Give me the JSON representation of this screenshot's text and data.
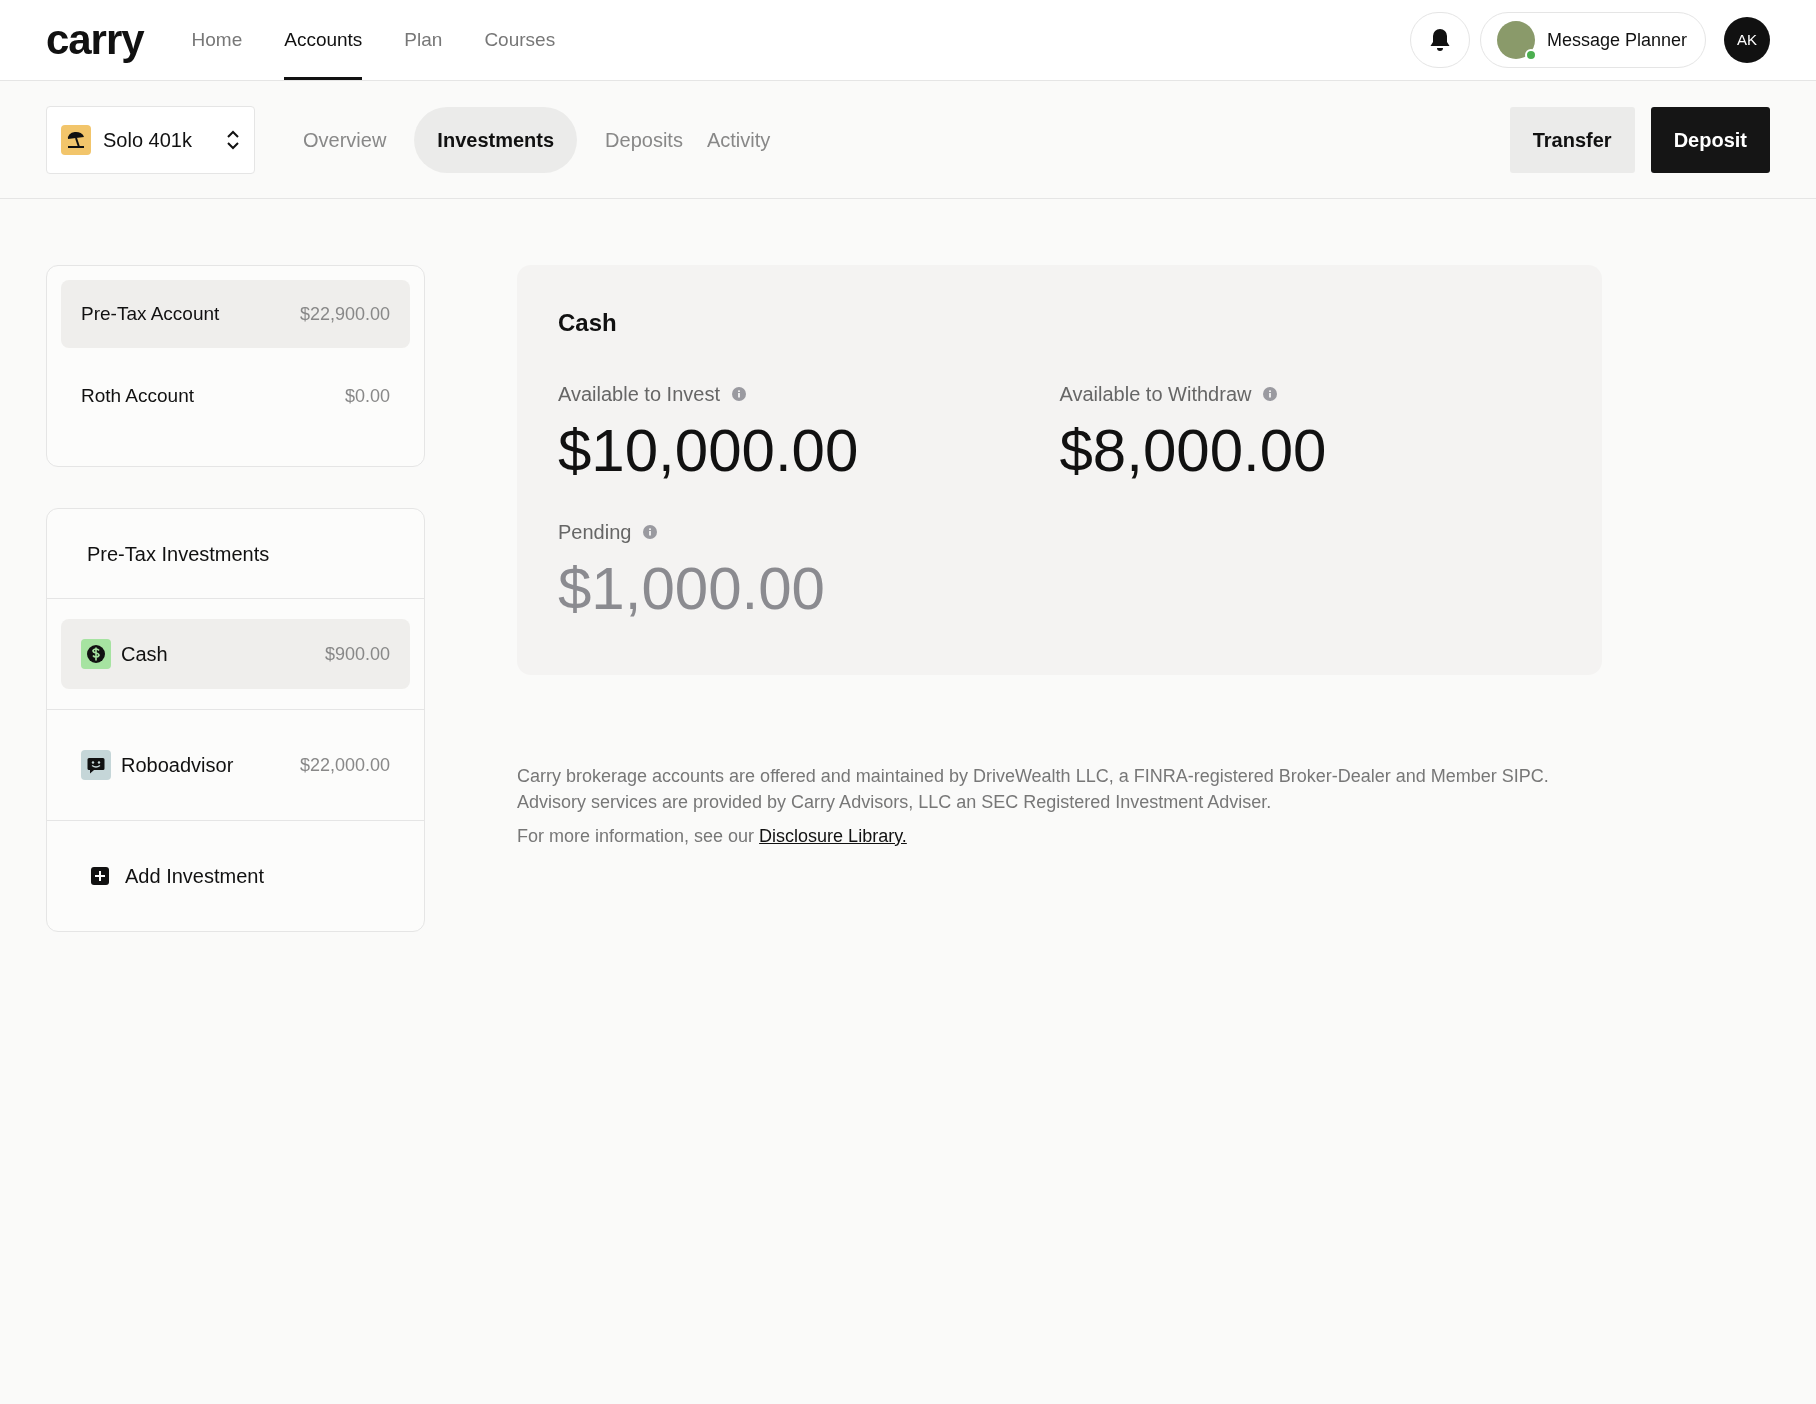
{
  "brand": "carry",
  "nav": [
    {
      "label": "Home",
      "selected": false
    },
    {
      "label": "Accounts",
      "selected": true
    },
    {
      "label": "Plan",
      "selected": false
    },
    {
      "label": "Courses",
      "selected": false
    }
  ],
  "header": {
    "message_planner": "Message Planner",
    "planner_online": true,
    "initials": "AK"
  },
  "account_selector": {
    "label": "Solo 401k"
  },
  "tabs": [
    {
      "label": "Overview",
      "selected": false
    },
    {
      "label": "Investments",
      "selected": true
    },
    {
      "label": "Deposits",
      "selected": false
    },
    {
      "label": "Activity",
      "selected": false
    }
  ],
  "actions": [
    {
      "label": "Transfer",
      "kind": "secondary"
    },
    {
      "label": "Deposit",
      "kind": "primary"
    }
  ],
  "accounts": [
    {
      "name": "Pre-Tax Account",
      "amount": "$22,900.00",
      "selected": true
    },
    {
      "name": "Roth Account",
      "amount": "$0.00",
      "selected": false
    }
  ],
  "investments": {
    "title": "Pre-Tax Investments",
    "items": [
      {
        "kind": "cash",
        "name": "Cash",
        "amount": "$900.00",
        "selected": true
      },
      {
        "kind": "robo",
        "name": "Roboadvisor",
        "amount": "$22,000.00",
        "selected": false
      }
    ],
    "add_label": "Add Investment"
  },
  "cash_panel": {
    "title": "Cash",
    "stats": [
      {
        "label": "Available to Invest",
        "value": "$10,000.00",
        "kind": "available"
      },
      {
        "label": "Available to Withdraw",
        "value": "$8,000.00",
        "kind": "available"
      },
      {
        "label": "Pending",
        "value": "$1,000.00",
        "kind": "pending"
      }
    ]
  },
  "disclosure": {
    "text": "Carry brokerage accounts are offered and maintained by DriveWealth LLC, a FINRA-registered Broker-Dealer and Member SIPC. Advisory services are provided by Carry Advisors, LLC an SEC Registered Investment Adviser.",
    "more": "For more information, see our",
    "link": "Disclosure Library."
  }
}
